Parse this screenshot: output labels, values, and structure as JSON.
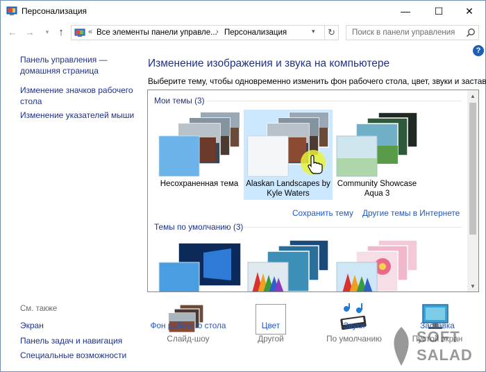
{
  "window": {
    "title": "Персонализация",
    "minimize_glyph": "—",
    "maximize_glyph": "☐",
    "close_glyph": "✕"
  },
  "nav": {
    "back_glyph": "←",
    "forward_glyph": "→",
    "recent_glyph": "▾",
    "up_glyph": "↑",
    "address_sep": "«",
    "breadcrumb_1": "Все элементы панели управле...",
    "breadcrumb_sep": "›",
    "breadcrumb_2": "Персонализация",
    "refresh_glyph": "↻",
    "search_placeholder": "Поиск в панели управления"
  },
  "sidebar": {
    "home_line1": "Панель управления —",
    "home_line2": "домашняя страница",
    "icons_line1": "Изменение значков рабочего",
    "icons_line2": "стола",
    "pointers": "Изменение указателей мыши",
    "see_also": "См. также",
    "screen": "Экран",
    "taskbar": "Панель задач и навигация",
    "accessibility": "Специальные возможности"
  },
  "help_glyph": "?",
  "main": {
    "title": "Изменение изображения и звука на компьютере",
    "description": "Выберите тему, чтобы одновременно изменить фон рабочего стола, цвет, звуки и заставку."
  },
  "themes": {
    "my_group": "Мои темы (3)",
    "default_group": "Темы по умолчанию (3)",
    "my_themes": [
      {
        "line1": "Несохраненная тема",
        "line2": ""
      },
      {
        "line1": "Alaskan Landscapes by",
        "line2": "Kyle Waters"
      },
      {
        "line1": "Community Showcase",
        "line2": "Aqua 3"
      }
    ],
    "save_theme": "Сохранить тему",
    "more_online": "Другие темы в Интернете",
    "scroll_up": "▲",
    "scroll_down": "▼"
  },
  "bottom": {
    "wallpaper_label": "Фон рабочего стола",
    "wallpaper_value": "Слайд-шоу",
    "color_label": "Цвет",
    "color_value": "Другой",
    "sounds_label": "Звуки",
    "sounds_value": "По умолчанию",
    "screensaver_label": "Заставка",
    "screensaver_value": "Пустой экран"
  },
  "watermark": {
    "line1": "SOFT",
    "line2": "SALAD"
  },
  "colors": {
    "link": "#1f57c3",
    "heading": "#1e3287",
    "selection": "#cce8ff",
    "accent_blue": "#1c5fb5"
  }
}
